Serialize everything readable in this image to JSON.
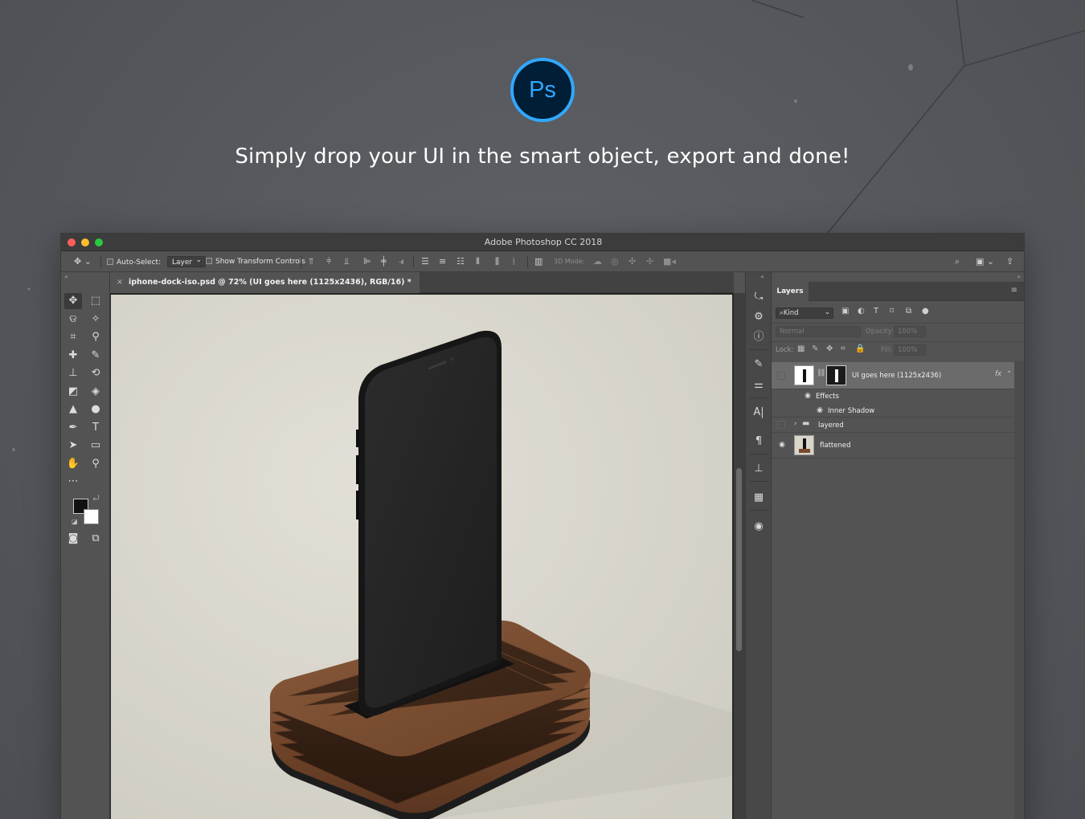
{
  "marketing": {
    "logo_text": "Ps",
    "headline": "Simply drop your UI in the smart object, export and done!"
  },
  "window": {
    "title": "Adobe Photoshop CC 2018"
  },
  "options_bar": {
    "auto_select_label": "Auto-Select:",
    "auto_select_value": "Layer",
    "show_transform_label": "Show Transform Controls",
    "mode_3d_label": "3D Mode:"
  },
  "document": {
    "tab_title": "iphone-dock-iso.psd @ 72% (UI goes here (1125x2436), RGB/16) *"
  },
  "colors": {
    "foreground": "#111111",
    "background": "#ffffff",
    "accent": "#31a8ff"
  },
  "layers_panel": {
    "tab_label": "Layers",
    "kind_label": "Kind",
    "blend_mode": "Normal",
    "opacity_label": "Opacity:",
    "opacity_value": "100%",
    "lock_label": "Lock:",
    "fill_label": "Fill:",
    "fill_value": "100%",
    "layers": [
      {
        "name": "UI goes here (1125x2436)",
        "fx": "fx"
      },
      {
        "name": "Effects"
      },
      {
        "name": "Inner Shadow"
      },
      {
        "name": "layered"
      },
      {
        "name": "flattened"
      }
    ]
  }
}
